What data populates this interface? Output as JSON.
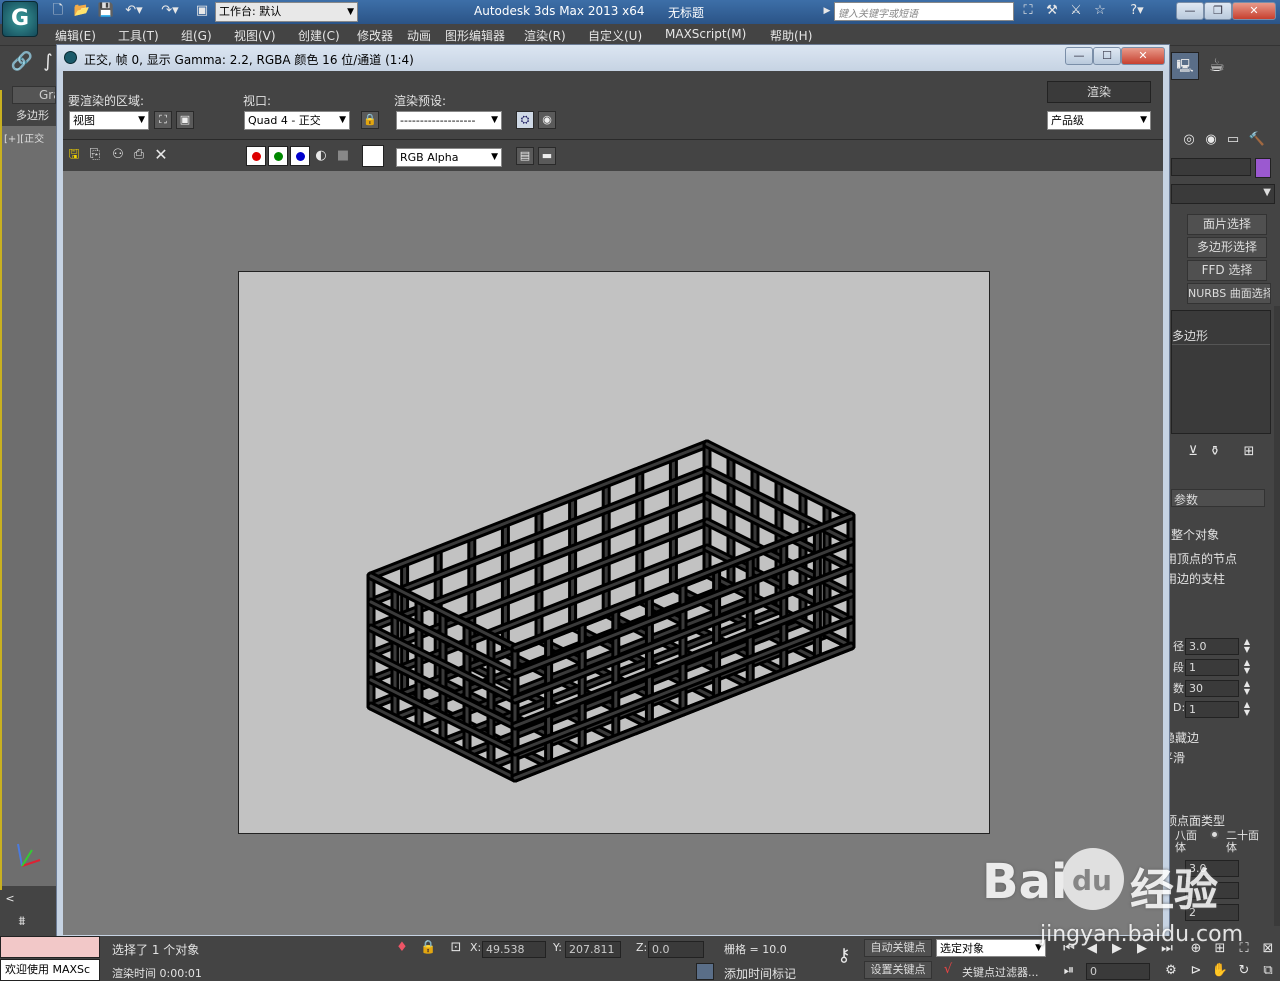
{
  "app": {
    "title": "Autodesk 3ds Max  2013 x64",
    "doc_title": "无标题",
    "workspace_label": "工作台: 默认",
    "search_placeholder": "键入关键字或短语",
    "brand_color": "#2b5487"
  },
  "menu": [
    "编辑(E)",
    "工具(T)",
    "组(G)",
    "视图(V)",
    "创建(C)",
    "修改器",
    "动画",
    "图形编辑器",
    "渲染(R)",
    "自定义(U)",
    "MAXScript(M)",
    "帮助(H)"
  ],
  "left_strip": {
    "tab1": "Gra",
    "tab2": "多边形",
    "viewport_label": "[+][正交"
  },
  "render_window": {
    "title": "正交, 帧 0, 显示 Gamma: 2.2, RGBA 颜色 16 位/通道 (1:4)",
    "area_label": "要渲染的区域:",
    "area_value": "视图",
    "viewport_label": "视口:",
    "viewport_value": "Quad 4 - 正交",
    "preset_label": "渲染预设:",
    "preset_value": "-------------------",
    "render_button": "渲染",
    "quality_value": "产品级",
    "channel_value": "RGB Alpha"
  },
  "right_panel": {
    "buttons": [
      "面片选择",
      "多边形选择",
      "FFD 选择",
      "NURBS 曲面选择"
    ],
    "stack_item": "多边形",
    "rollout_title": "参数",
    "options": [
      "整个对象",
      "用顶点的节点",
      "用边的支柱"
    ],
    "spinners": [
      {
        "label": "径:",
        "value": "3.0"
      },
      {
        "label": "段:",
        "value": "1"
      },
      {
        "label": "数:",
        "value": "30"
      },
      {
        "label": "D:",
        "value": "1"
      }
    ],
    "hide_edge": "隐藏边",
    "smooth": "平滑",
    "vertex_type": "顶点面类型",
    "octa": "八面体",
    "icosa": "二十面体",
    "radius2": "3.0",
    "extra_spin": "2"
  },
  "status": {
    "selection": "选择了 1 个对象",
    "x_label": "X:",
    "x_value": "49.538",
    "y_label": "Y:",
    "y_value": "207.811",
    "z_label": "Z:",
    "z_value": "0.0",
    "grid": "栅格 = 10.0",
    "auto_key": "自动关键点",
    "set_key": "设置关键点",
    "selected_obj": "选定对象",
    "key_filter": "关键点过滤器...",
    "render_time": "渲染时间  0:00:01",
    "add_time_tag": "添加时间标记",
    "frame_value": "0",
    "welcome": "欢迎使用 MAXSc"
  },
  "watermark": {
    "brand": "Bai",
    "paw": "du",
    "cn": "经验",
    "url": "jingyan.baidu.com"
  },
  "colors": {
    "red_channel": "#dd0000",
    "green_channel": "#008800",
    "blue_channel": "#0000cc",
    "purple_swatch": "#9b59d0"
  }
}
